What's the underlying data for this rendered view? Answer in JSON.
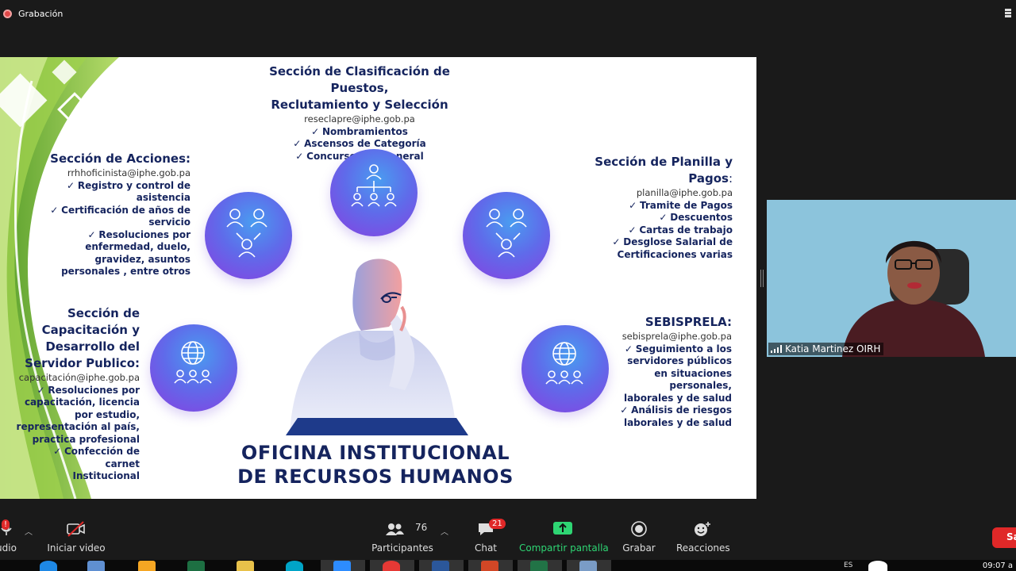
{
  "recording": {
    "label": "Grabación"
  },
  "slide": {
    "center_section": {
      "title_line1": "Sección de Clasificación de Puestos,",
      "title_line2": "Reclutamiento y Selección",
      "email": "reseclapre@iphe.gob.pa",
      "items": [
        "Nombramientos",
        "Ascensos de Categoría",
        "Concursos en General"
      ]
    },
    "acciones": {
      "title": "Sección de Acciones:",
      "email": "rrhhoficinista@iphe.gob.pa",
      "lines": [
        "Registro y control de",
        "asistencia",
        "Certificación de años de",
        "servicio",
        "Resoluciones por",
        "enfermedad, duelo,",
        "gravidez, asuntos",
        "personales , entre otros"
      ]
    },
    "planilla": {
      "title_line1": "Sección de Planilla y",
      "title_line2": "Pagos",
      "title_colon": ":",
      "email": "planilla@iphe.gob.pa",
      "lines": [
        "Tramite de Pagos",
        "Descuentos",
        "Cartas de trabajo",
        "Desglose Salarial de",
        "Certificaciones varias"
      ]
    },
    "capacitacion": {
      "title_lines": [
        "Sección de",
        "Capacitación y",
        "Desarrollo del",
        "Servidor Publico:"
      ],
      "email": "capacitación@iphe.gob.pa",
      "lines": [
        "Resoluciones por",
        "capacitación, licencia",
        "por estudio,",
        "representación al país,",
        "practica profesional",
        "Confección de carnet",
        "Institucional"
      ]
    },
    "sebisprela": {
      "title": "SEBISPRELA:",
      "email": "sebisprela@iphe.gob.pa",
      "lines": [
        "Seguimiento a los",
        "servidores públicos",
        "en situaciones",
        "personales,",
        "laborales y de salud",
        "Análisis de riesgos",
        "laborales y de salud"
      ]
    },
    "main_title_line1": "OFICINA INSTITUCIONAL",
    "main_title_line2": "DE RECURSOS HUMANOS",
    "accent_colors": {
      "navy": "#15245e",
      "circle_start": "#4a9cf0",
      "circle_end": "#8a3ee0",
      "green": "#8cc63f"
    }
  },
  "participant": {
    "name": "Katia Martinez OIRH"
  },
  "toolbar": {
    "audio_label": "udio",
    "video_label": "Iniciar video",
    "participants_label": "Participantes",
    "participants_count": "76",
    "chat_label": "Chat",
    "chat_badge": "21",
    "share_label": "Compartir pantalla",
    "record_label": "Grabar",
    "reactions_label": "Reacciones",
    "leave_label": "Sa",
    "audio_badge": "!"
  },
  "taskbar": {
    "time": "09:07 a",
    "lang": "ES"
  }
}
